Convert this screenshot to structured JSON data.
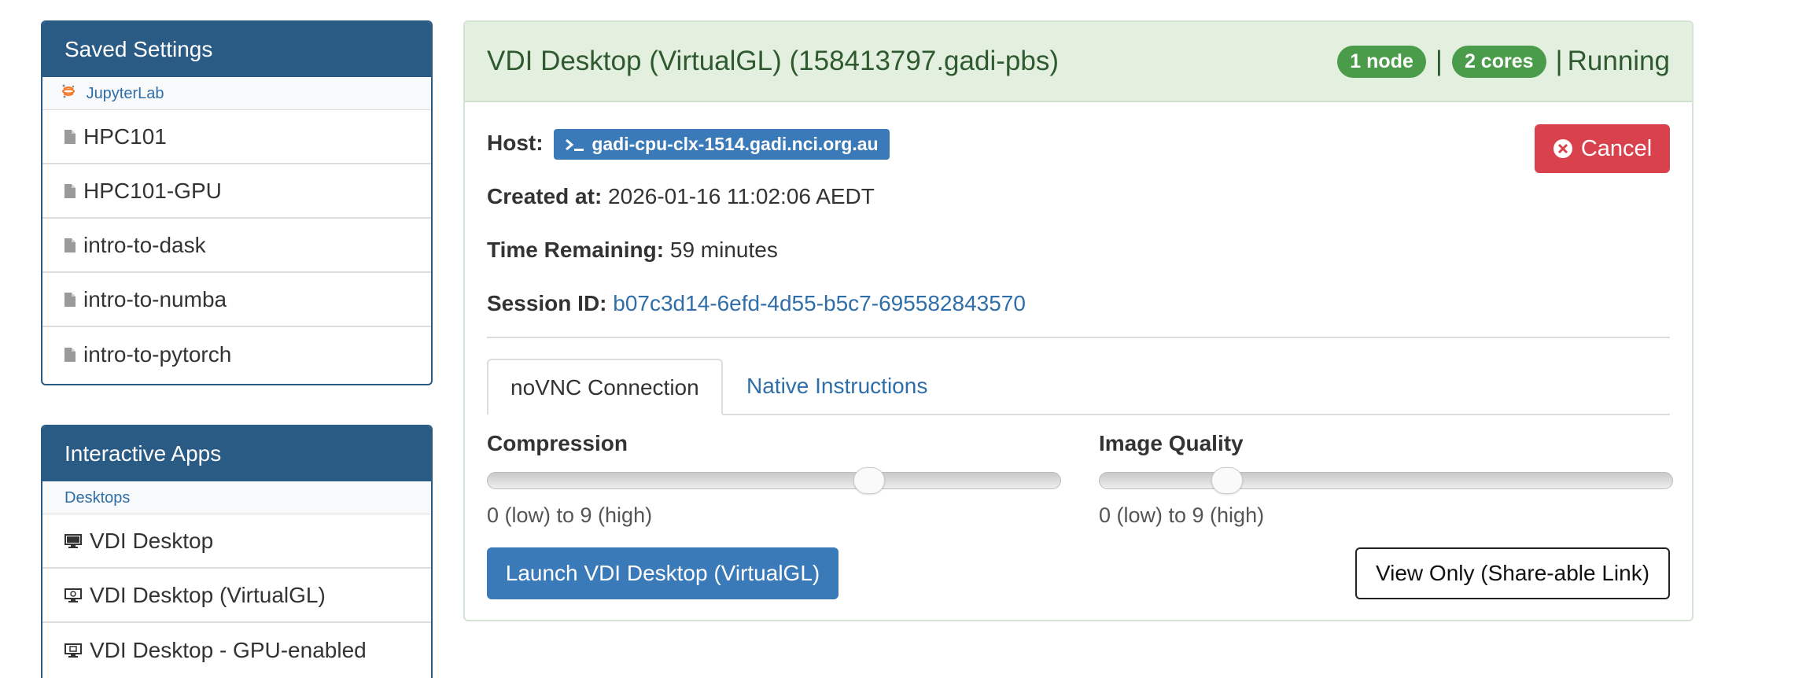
{
  "sidebar": {
    "saved": {
      "title": "Saved Settings",
      "category": "JupyterLab",
      "items": [
        {
          "label": "HPC101"
        },
        {
          "label": "HPC101-GPU"
        },
        {
          "label": "intro-to-dask"
        },
        {
          "label": "intro-to-numba"
        },
        {
          "label": "intro-to-pytorch"
        }
      ]
    },
    "apps": {
      "title": "Interactive Apps",
      "category": "Desktops",
      "items": [
        {
          "label": "VDI Desktop",
          "icon": "monitor-icon"
        },
        {
          "label": "VDI Desktop (VirtualGL)",
          "icon": "monitor-gl-icon"
        },
        {
          "label": "VDI Desktop - GPU-enabled",
          "icon": "monitor-gpu-icon"
        }
      ]
    }
  },
  "session": {
    "title": "VDI Desktop (VirtualGL) (158413797.gadi-pbs)",
    "nodes": "1 node",
    "cores": "2 cores",
    "separator": "|",
    "status": "Running",
    "host_label": "Host:",
    "host_value": "gadi-cpu-clx-1514.gadi.nci.org.au",
    "created_label": "Created at:",
    "created_value": "2026-01-16 11:02:06 AEDT",
    "remaining_label": "Time Remaining:",
    "remaining_value": "59 minutes",
    "session_id_label": "Session ID:",
    "session_id_value": "b07c3d14-6efd-4d55-b5c7-695582843570",
    "cancel_label": "Cancel",
    "tabs": [
      {
        "label": "noVNC Connection",
        "active": true
      },
      {
        "label": "Native Instructions",
        "active": false
      }
    ],
    "compression": {
      "label": "Compression",
      "help": "0 (low) to 9 (high)",
      "value": 6,
      "max": 9
    },
    "image_quality": {
      "label": "Image Quality",
      "help": "0 (low) to 9 (high)",
      "value": 2,
      "max": 9
    },
    "launch_label": "Launch VDI Desktop (VirtualGL)",
    "view_only_label": "View Only (Share-able Link)"
  },
  "colors": {
    "panel_header": "#2a5b84",
    "success_bg": "#e3f0e0",
    "badge_green": "#4a9c4a",
    "primary": "#3a7ab8",
    "danger": "#d9414d"
  }
}
